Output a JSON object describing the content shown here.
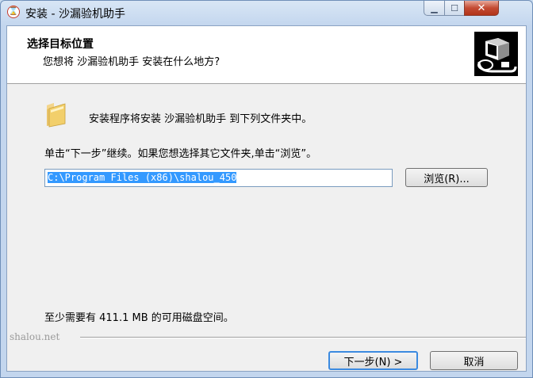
{
  "window": {
    "title": "安装 - 沙漏验机助手",
    "min_glyph": "▁",
    "max_glyph": "☐",
    "close_glyph": "✕"
  },
  "header": {
    "title": "选择目标位置",
    "subtitle": "您想将 沙漏验机助手 安装在什么地方?"
  },
  "main": {
    "intro_text": "安装程序将安装 沙漏验机助手 到下列文件夹中。",
    "instruction_text": "单击“下一步”继续。如果您想选择其它文件夹,单击“浏览”。",
    "install_path": "C:\\Program Files (x86)\\shalou_450",
    "browse_label": "浏览(R)...",
    "space_required": "至少需要有 411.1 MB 的可用磁盘空间。"
  },
  "footer": {
    "brand": "shalou.net",
    "next_label": "下一步(N) >",
    "cancel_label": "取消"
  },
  "icons": {
    "app": "hourglass-icon",
    "folder": "folder-icon",
    "logo": "installer-logo-icon"
  }
}
